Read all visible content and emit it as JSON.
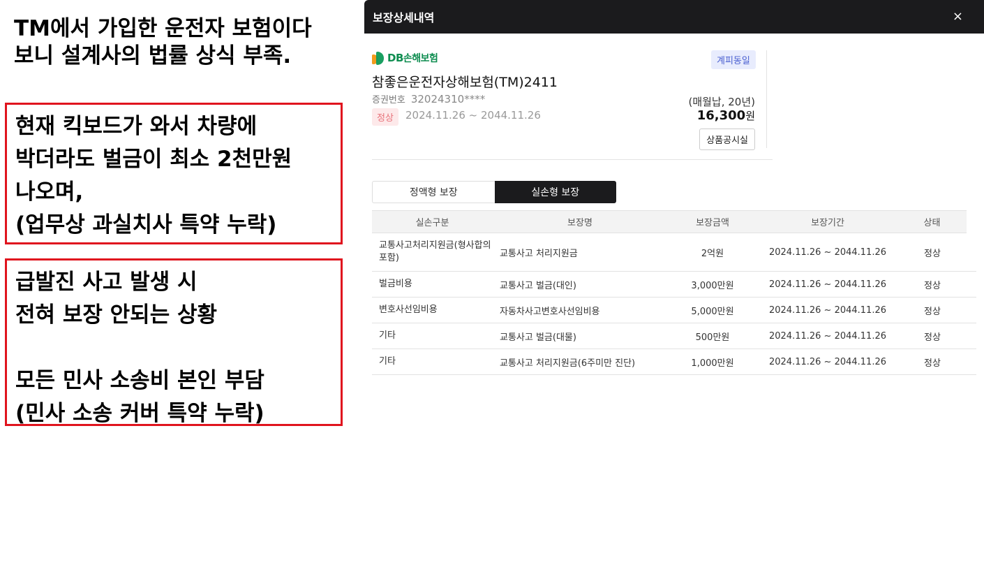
{
  "annotation": {
    "title": "TM에서 가입한 운전자 보험이다\n보니 설계사의 법률 상식 부족.",
    "box1": "현재 킥보드가 와서 차량에\n박더라도 벌금이 최소 2천만원\n나오며,\n(업무상 과실치사 특약 누락)",
    "box2": "급발진 사고 발생 시\n전혀 보장 안되는 상황\n\n모든 민사 소송비 본인 부담\n(민사 소송 커버 특약 누락)"
  },
  "modal": {
    "title": "보장상세내역",
    "close_symbol": "×",
    "insurer_logo": {
      "db": "DB",
      "name": "손해보험"
    },
    "renew_badge": "계피동일",
    "product_name": "참좋은운전자상해보험(TM)2411",
    "policy_no_label": "증권번호",
    "policy_no": "32024310****",
    "status": "정상",
    "period": "2024.11.26 ~ 2044.11.26",
    "payment_info": "(매월납, 20년)",
    "premium_amount": "16,300",
    "premium_unit": "원",
    "disclosure_button": "상품공시실",
    "tabs": [
      {
        "label": "정액형 보장",
        "active": false
      },
      {
        "label": "실손형 보장",
        "active": true
      }
    ],
    "table": {
      "headers": [
        "실손구분",
        "보장명",
        "보장금액",
        "보장기간",
        "상태"
      ],
      "rows": [
        [
          "교통사고처리지원금(형사합의포함)",
          "교통사고 처리지원금",
          "2억원",
          "2024.11.26 ~ 2044.11.26",
          "정상"
        ],
        [
          "벌금비용",
          "교통사고 벌금(대인)",
          "3,000만원",
          "2024.11.26 ~ 2044.11.26",
          "정상"
        ],
        [
          "변호사선임비용",
          "자동차사고변호사선임비용",
          "5,000만원",
          "2024.11.26 ~ 2044.11.26",
          "정상"
        ],
        [
          "기타",
          "교통사고 벌금(대물)",
          "500만원",
          "2024.11.26 ~ 2044.11.26",
          "정상"
        ],
        [
          "기타",
          "교통사고 처리지원금(6주미만 진단)",
          "1,000만원",
          "2024.11.26 ~ 2044.11.26",
          "정상"
        ]
      ]
    }
  }
}
